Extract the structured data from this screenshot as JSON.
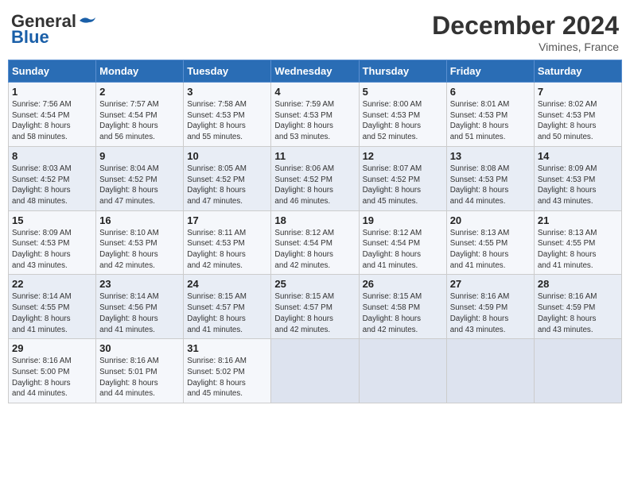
{
  "header": {
    "logo_line1": "General",
    "logo_line2": "Blue",
    "month_year": "December 2024",
    "location": "Vimines, France"
  },
  "days_of_week": [
    "Sunday",
    "Monday",
    "Tuesday",
    "Wednesday",
    "Thursday",
    "Friday",
    "Saturday"
  ],
  "weeks": [
    [
      {
        "day": 1,
        "lines": [
          "Sunrise: 7:56 AM",
          "Sunset: 4:54 PM",
          "Daylight: 8 hours",
          "and 58 minutes."
        ]
      },
      {
        "day": 2,
        "lines": [
          "Sunrise: 7:57 AM",
          "Sunset: 4:54 PM",
          "Daylight: 8 hours",
          "and 56 minutes."
        ]
      },
      {
        "day": 3,
        "lines": [
          "Sunrise: 7:58 AM",
          "Sunset: 4:53 PM",
          "Daylight: 8 hours",
          "and 55 minutes."
        ]
      },
      {
        "day": 4,
        "lines": [
          "Sunrise: 7:59 AM",
          "Sunset: 4:53 PM",
          "Daylight: 8 hours",
          "and 53 minutes."
        ]
      },
      {
        "day": 5,
        "lines": [
          "Sunrise: 8:00 AM",
          "Sunset: 4:53 PM",
          "Daylight: 8 hours",
          "and 52 minutes."
        ]
      },
      {
        "day": 6,
        "lines": [
          "Sunrise: 8:01 AM",
          "Sunset: 4:53 PM",
          "Daylight: 8 hours",
          "and 51 minutes."
        ]
      },
      {
        "day": 7,
        "lines": [
          "Sunrise: 8:02 AM",
          "Sunset: 4:53 PM",
          "Daylight: 8 hours",
          "and 50 minutes."
        ]
      }
    ],
    [
      {
        "day": 8,
        "lines": [
          "Sunrise: 8:03 AM",
          "Sunset: 4:52 PM",
          "Daylight: 8 hours",
          "and 48 minutes."
        ]
      },
      {
        "day": 9,
        "lines": [
          "Sunrise: 8:04 AM",
          "Sunset: 4:52 PM",
          "Daylight: 8 hours",
          "and 47 minutes."
        ]
      },
      {
        "day": 10,
        "lines": [
          "Sunrise: 8:05 AM",
          "Sunset: 4:52 PM",
          "Daylight: 8 hours",
          "and 47 minutes."
        ]
      },
      {
        "day": 11,
        "lines": [
          "Sunrise: 8:06 AM",
          "Sunset: 4:52 PM",
          "Daylight: 8 hours",
          "and 46 minutes."
        ]
      },
      {
        "day": 12,
        "lines": [
          "Sunrise: 8:07 AM",
          "Sunset: 4:52 PM",
          "Daylight: 8 hours",
          "and 45 minutes."
        ]
      },
      {
        "day": 13,
        "lines": [
          "Sunrise: 8:08 AM",
          "Sunset: 4:53 PM",
          "Daylight: 8 hours",
          "and 44 minutes."
        ]
      },
      {
        "day": 14,
        "lines": [
          "Sunrise: 8:09 AM",
          "Sunset: 4:53 PM",
          "Daylight: 8 hours",
          "and 43 minutes."
        ]
      }
    ],
    [
      {
        "day": 15,
        "lines": [
          "Sunrise: 8:09 AM",
          "Sunset: 4:53 PM",
          "Daylight: 8 hours",
          "and 43 minutes."
        ]
      },
      {
        "day": 16,
        "lines": [
          "Sunrise: 8:10 AM",
          "Sunset: 4:53 PM",
          "Daylight: 8 hours",
          "and 42 minutes."
        ]
      },
      {
        "day": 17,
        "lines": [
          "Sunrise: 8:11 AM",
          "Sunset: 4:53 PM",
          "Daylight: 8 hours",
          "and 42 minutes."
        ]
      },
      {
        "day": 18,
        "lines": [
          "Sunrise: 8:12 AM",
          "Sunset: 4:54 PM",
          "Daylight: 8 hours",
          "and 42 minutes."
        ]
      },
      {
        "day": 19,
        "lines": [
          "Sunrise: 8:12 AM",
          "Sunset: 4:54 PM",
          "Daylight: 8 hours",
          "and 41 minutes."
        ]
      },
      {
        "day": 20,
        "lines": [
          "Sunrise: 8:13 AM",
          "Sunset: 4:55 PM",
          "Daylight: 8 hours",
          "and 41 minutes."
        ]
      },
      {
        "day": 21,
        "lines": [
          "Sunrise: 8:13 AM",
          "Sunset: 4:55 PM",
          "Daylight: 8 hours",
          "and 41 minutes."
        ]
      }
    ],
    [
      {
        "day": 22,
        "lines": [
          "Sunrise: 8:14 AM",
          "Sunset: 4:55 PM",
          "Daylight: 8 hours",
          "and 41 minutes."
        ]
      },
      {
        "day": 23,
        "lines": [
          "Sunrise: 8:14 AM",
          "Sunset: 4:56 PM",
          "Daylight: 8 hours",
          "and 41 minutes."
        ]
      },
      {
        "day": 24,
        "lines": [
          "Sunrise: 8:15 AM",
          "Sunset: 4:57 PM",
          "Daylight: 8 hours",
          "and 41 minutes."
        ]
      },
      {
        "day": 25,
        "lines": [
          "Sunrise: 8:15 AM",
          "Sunset: 4:57 PM",
          "Daylight: 8 hours",
          "and 42 minutes."
        ]
      },
      {
        "day": 26,
        "lines": [
          "Sunrise: 8:15 AM",
          "Sunset: 4:58 PM",
          "Daylight: 8 hours",
          "and 42 minutes."
        ]
      },
      {
        "day": 27,
        "lines": [
          "Sunrise: 8:16 AM",
          "Sunset: 4:59 PM",
          "Daylight: 8 hours",
          "and 43 minutes."
        ]
      },
      {
        "day": 28,
        "lines": [
          "Sunrise: 8:16 AM",
          "Sunset: 4:59 PM",
          "Daylight: 8 hours",
          "and 43 minutes."
        ]
      }
    ],
    [
      {
        "day": 29,
        "lines": [
          "Sunrise: 8:16 AM",
          "Sunset: 5:00 PM",
          "Daylight: 8 hours",
          "and 44 minutes."
        ]
      },
      {
        "day": 30,
        "lines": [
          "Sunrise: 8:16 AM",
          "Sunset: 5:01 PM",
          "Daylight: 8 hours",
          "and 44 minutes."
        ]
      },
      {
        "day": 31,
        "lines": [
          "Sunrise: 8:16 AM",
          "Sunset: 5:02 PM",
          "Daylight: 8 hours",
          "and 45 minutes."
        ]
      },
      null,
      null,
      null,
      null
    ]
  ]
}
